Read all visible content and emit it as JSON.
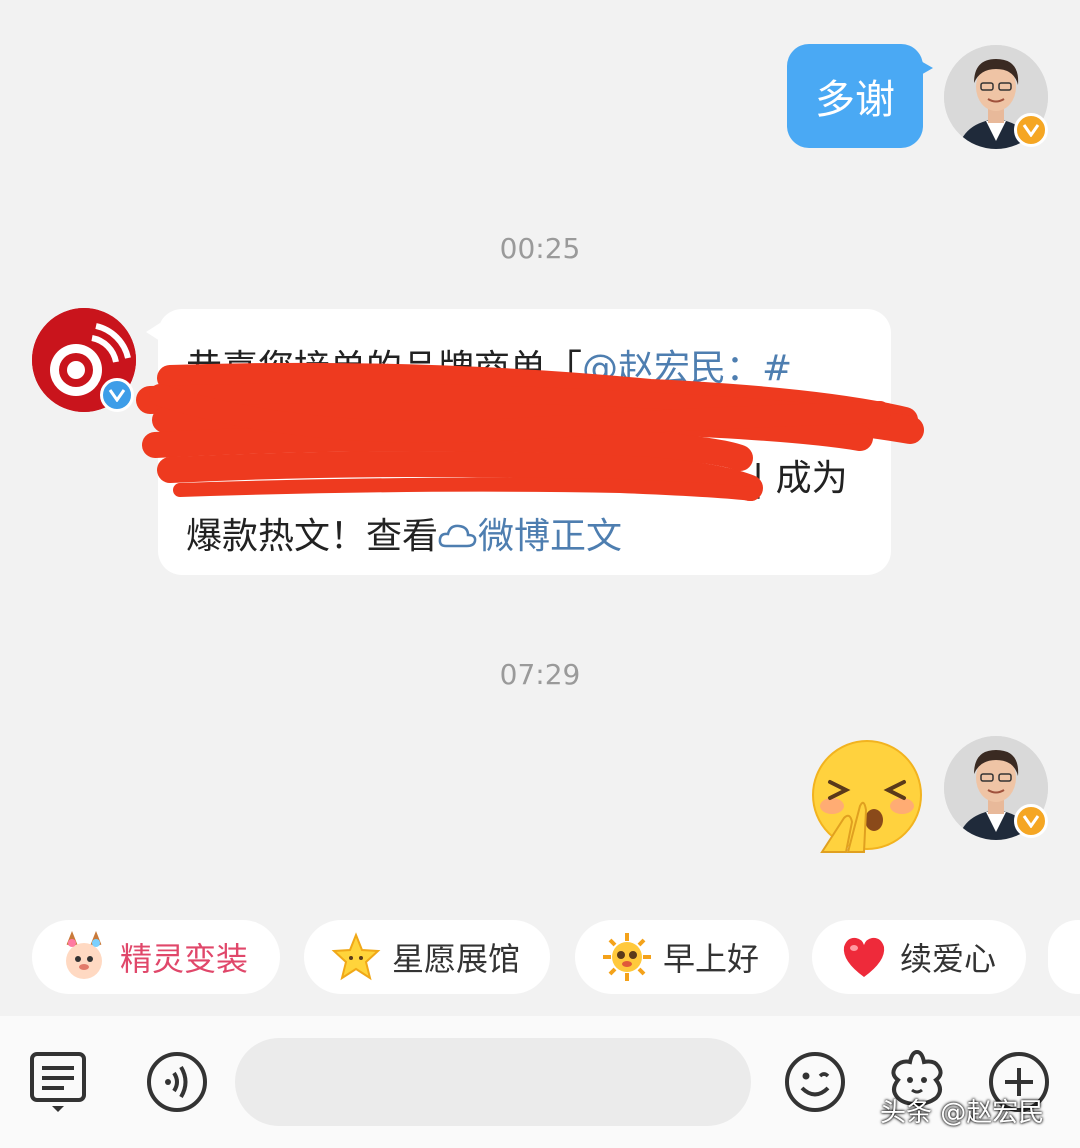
{
  "messages": {
    "first_outgoing": "多谢",
    "time_1": "00:25",
    "notice_line1_plain": "恭喜您接单的品牌商单「",
    "notice_line1_link": "@赵宏民：#",
    "notice_line3_tail": "| 成为",
    "notice_line4_plain": "爆款热文！查看",
    "notice_line4_link": "微博正文",
    "time_2": "07:29",
    "second_outgoing_emoji": "pray-emoji"
  },
  "chips": [
    {
      "label": "精灵变装",
      "icon": "fairy-deer-icon",
      "color": "#e0476a"
    },
    {
      "label": "星愿展馆",
      "icon": "star-icon",
      "color": "#333333"
    },
    {
      "label": "早上好",
      "icon": "sun-face-icon",
      "color": "#333333"
    },
    {
      "label": "续爱心",
      "icon": "heart-icon",
      "color": "#333333"
    }
  ],
  "toolbar": {
    "icons": [
      "menu-list-icon",
      "voice-icon",
      "emoji-icon",
      "star-face-icon",
      "plus-icon"
    ]
  },
  "watermark": "头条 @赵宏民",
  "colors": {
    "accent": "#4aa9f4",
    "link": "#4e7eb0",
    "background": "#f2f2f2",
    "redact": "#ee3a1f",
    "verified_orange": "#f5a623",
    "verified_blue": "#3d9de8"
  }
}
